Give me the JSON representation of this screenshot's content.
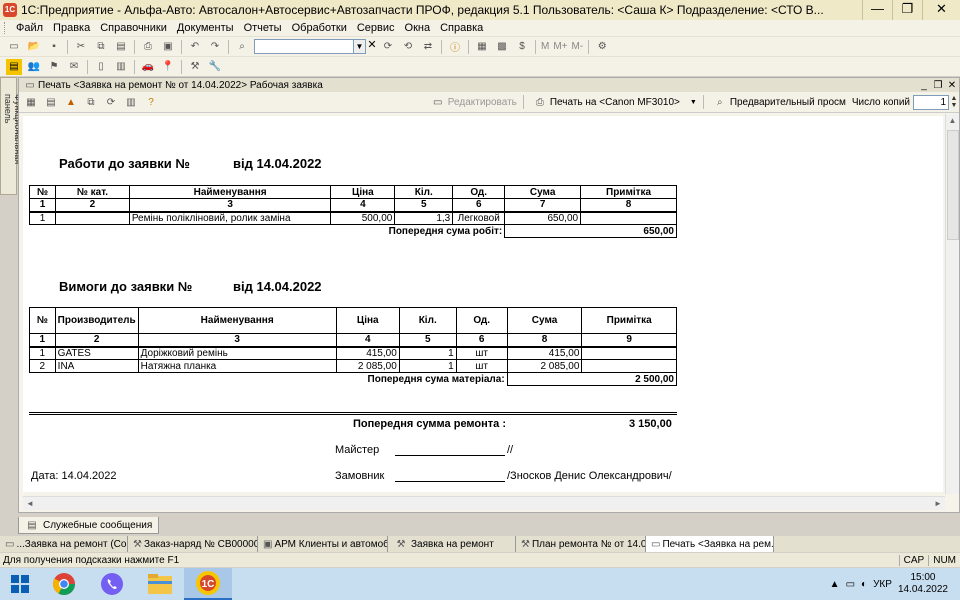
{
  "window": {
    "title": "1С:Предприятие - Альфа-Авто: Автосалон+Автосервис+Автозапчасти ПРОФ, редакция 5.1    Пользователь: <Саша К>    Подразделение: <СТО В...",
    "minimize": "—",
    "restore": "❐",
    "close": "✕"
  },
  "menu": [
    "Файл",
    "Правка",
    "Справочники",
    "Документы",
    "Отчеты",
    "Обработки",
    "Сервис",
    "Окна",
    "Справка"
  ],
  "toolbar": {
    "m_labels": [
      "M",
      "M+",
      "M-"
    ]
  },
  "side_panel": {
    "label": "Функциональная панель"
  },
  "document": {
    "title": "Печать <Заявка на ремонт №        от 14.04.2022> Рабочая заявка",
    "edit_label": "Редактировать",
    "print_label": "Печать на <Canon MF3010>",
    "preview_label": "Предварительный просмотр",
    "copies_label": "Число копий",
    "copies_value": "1"
  },
  "report": {
    "works": {
      "title": "Работи до заявки №",
      "date": "від 14.04.2022",
      "headers": [
        "№",
        "№ кат.",
        "Найменування",
        "Ціна",
        "Кіл.",
        "Од.",
        "Сума",
        "Примітка"
      ],
      "index": [
        "1",
        "2",
        "3",
        "4",
        "5",
        "6",
        "7",
        "8"
      ],
      "rows": [
        [
          "1",
          "",
          "Ремінь полікліновий, ролик заміна",
          "500,00",
          "1,3",
          "Легковой",
          "650,00",
          ""
        ]
      ],
      "total_label": "Попередня  сума робіт:",
      "total_value": "650,00"
    },
    "materials": {
      "title": "Вимоги до заявки №",
      "date": "від 14.04.2022",
      "headers": [
        "№",
        "Производитель",
        "Найменування",
        "Ціна",
        "Кіл.",
        "Од.",
        "Сума",
        "Примітка"
      ],
      "index": [
        "1",
        "2",
        "3",
        "4",
        "5",
        "6",
        "8",
        "9"
      ],
      "rows": [
        [
          "1",
          "GATES",
          "Доріжковий ремінь",
          "415,00",
          "1",
          "шт",
          "415,00",
          ""
        ],
        [
          "2",
          "INA",
          "Натяжна планка",
          "2 085,00",
          "1",
          "шт",
          "2 085,00",
          ""
        ]
      ],
      "total_label": "Попередня сума матеріала:",
      "total_value": "2 500,00"
    },
    "grand_total_label": "Попередня сумма ремонта :",
    "grand_total_value": "3 150,00",
    "master_label": "Майстер",
    "master_suffix": "//",
    "date_label": "Дата: 14.04.2022",
    "customer_label": "Замовник",
    "customer_name": "/Зносков Денис Олександрович/"
  },
  "messages_tab": "Служебные сообщения",
  "window_tabs": [
    "...Заявка на ремонт (Со...",
    "Заказ-наряд № СВ00000...",
    "АРМ Клиенты и автомоб...",
    "Заявка на ремонт",
    "План ремонта №  от 14.0...",
    "Печать <Заявка на рем..."
  ],
  "status": {
    "hint": "Для получения подсказки нажмите F1",
    "cap": "CAP",
    "num": "NUM"
  },
  "taskbar": {
    "apps": [
      "windows-start",
      "chrome",
      "viber",
      "file-explorer",
      "1c"
    ],
    "lang": "УКР",
    "time": "15:00",
    "date": "14.04.2022"
  }
}
